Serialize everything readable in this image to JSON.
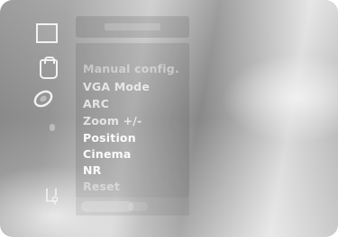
{
  "menu": {
    "items": [
      {
        "label": "Manual config."
      },
      {
        "label": "VGA Mode"
      },
      {
        "label": "ARC"
      },
      {
        "label": "Zoom +/-"
      },
      {
        "label": "Position"
      },
      {
        "label": "Cinema"
      },
      {
        "label": "NR"
      },
      {
        "label": "Reset"
      }
    ]
  },
  "icons": {
    "column": [
      "picture-icon",
      "sound-icon",
      "screen-icon",
      "menu-icon",
      "lock-icon"
    ]
  },
  "colors": {
    "text": "#ffffff",
    "panel": "#5a5a5a"
  }
}
